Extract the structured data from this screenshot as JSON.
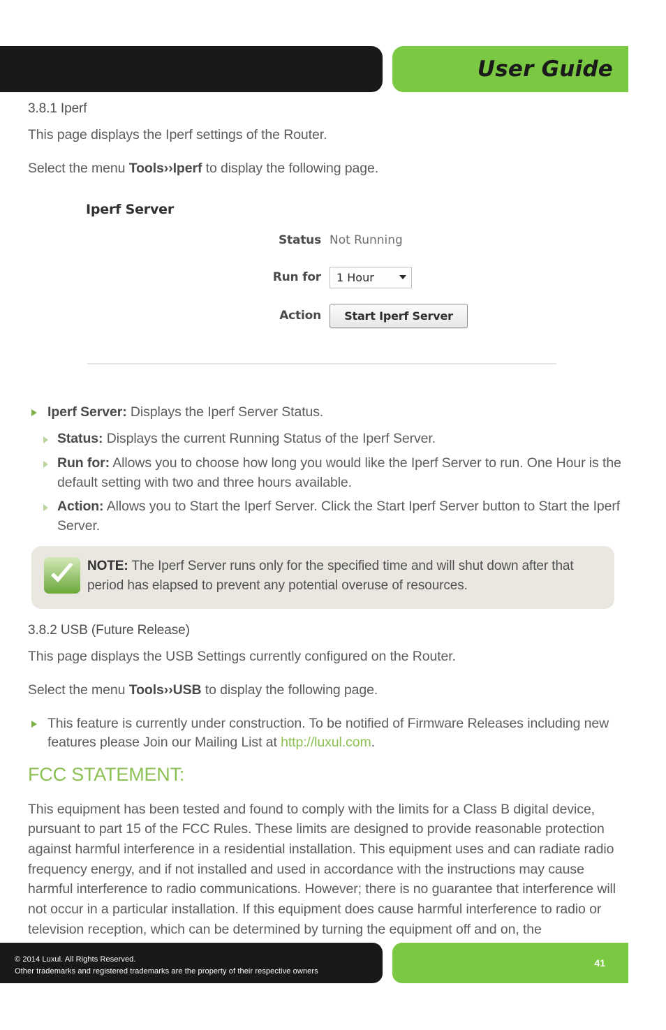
{
  "header": {
    "title": "User Guide"
  },
  "sections": {
    "iperf": {
      "heading": "3.8.1 Iperf",
      "intro": "This page displays the Iperf settings of the Router.",
      "menu_prefix": "Select the menu ",
      "menu_path": "Tools››Iperf",
      "menu_suffix": " to display the following page."
    },
    "usb": {
      "heading": "3.8.2 USB (Future Release)",
      "intro": "This page displays the USB Settings currently configured on the Router.",
      "menu_prefix": "Select the menu ",
      "menu_path": "Tools››USB",
      "menu_suffix": " to display the following page.",
      "bullet_prefix": "This feature is currently under construction. To be notified of Firmware Releases including new features please Join our Mailing List at ",
      "bullet_link": "http://luxul.com",
      "bullet_suffix": "."
    }
  },
  "ui_screenshot": {
    "panel_title": "Iperf Server",
    "status_label": "Status",
    "status_value": "Not Running",
    "runfor_label": "Run for",
    "runfor_value": "1 Hour",
    "action_label": "Action",
    "action_button": "Start Iperf Server"
  },
  "descriptions": {
    "server_term": "Iperf Server:",
    "server_text": " Displays the Iperf Server Status.",
    "items": [
      {
        "term": "Status:",
        "text": " Displays the current Running Status of the Iperf Server."
      },
      {
        "term": "Run for:",
        "text": " Allows you to choose how long you would like the Iperf Server to run. One Hour is the default setting with two and three hours available."
      },
      {
        "term": "Action:",
        "text": " Allows you to Start the Iperf Server. Click the Start Iperf Server button to Start the Iperf Server."
      }
    ]
  },
  "note": {
    "label": "NOTE:",
    "text": " The Iperf Server runs only for the specified time and will shut down after that period has elapsed to prevent any potential overuse of resources."
  },
  "fcc": {
    "heading": "FCC STATEMENT:",
    "body": "This equipment has been tested and found to comply with the limits for a Class B digital device, pursuant to part 15 of the FCC Rules. These limits are designed to provide reasonable protection against harmful interference in a residential installation. This equipment uses and can radiate radio frequency energy, and if not installed and used in accordance with the instructions may cause harmful interference to radio communications. However; there is no guarantee that interference will not occur in a particular installation. If this equipment does cause harmful interference to radio or television reception, which can be determined by turning the equipment off and on, the"
  },
  "footer": {
    "copyright_line1": "© 2014  Luxul. All Rights Reserved.",
    "copyright_line2": "Other trademarks and registered trademarks are the property of their respective owners",
    "page_number": "41"
  },
  "colors": {
    "brand_green": "#7bc943",
    "accent_green": "#8cbf54",
    "dark_bar": "#19181a",
    "note_bg": "#eae7e1"
  }
}
